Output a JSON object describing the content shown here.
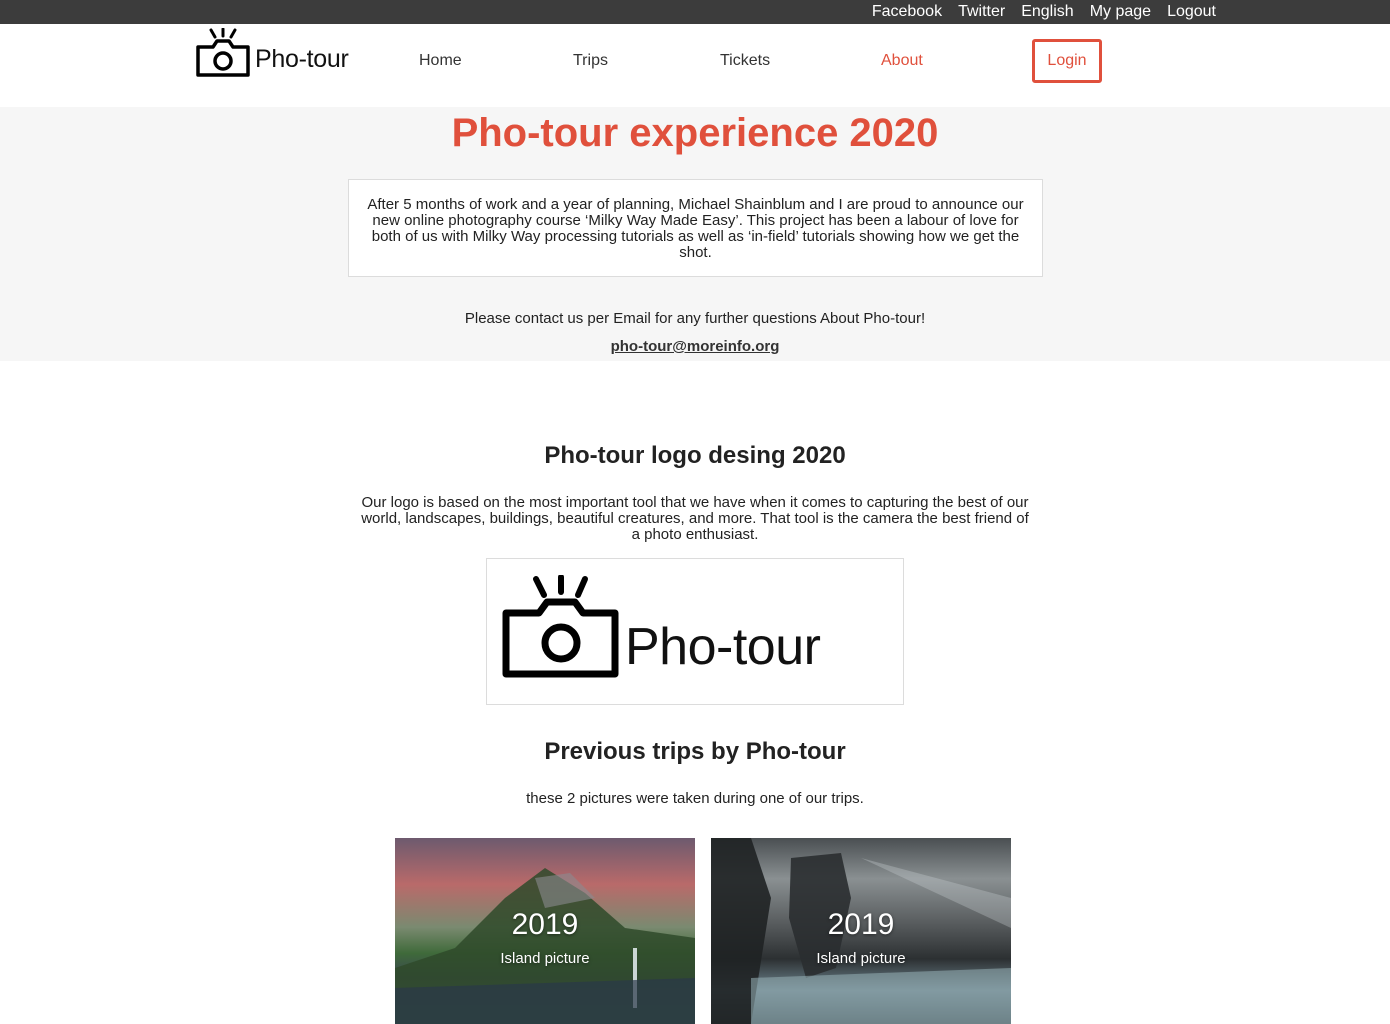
{
  "topbar": {
    "links": [
      "Facebook",
      "Twitter",
      "English",
      "My page",
      "Logout"
    ]
  },
  "header": {
    "logo_text": "Pho-tour",
    "nav": {
      "home": "Home",
      "trips": "Trips",
      "tickets": "Tickets",
      "about": "About"
    },
    "login_label": "Login",
    "accent_color": "#e0503c"
  },
  "hero": {
    "title": "Pho-tour experience 2020",
    "announcement": "After 5 months of work and a year of planning, Michael Shainblum and I are proud to announce our new online photography course ‘Milky Way Made Easy’. This project has been a labour of love for both of us with Milky Way processing tutorials as well as ‘in-field’ tutorials showing how we get the shot.",
    "contact_text": "Please contact us per Email for any further questions About Pho-tour!",
    "email": "pho-tour@moreinfo.org"
  },
  "logo_section": {
    "heading": "Pho-tour logo desing 2020",
    "description": "Our logo is based on the most important tool that we have when it comes to capturing the best of our world, landscapes, buildings, beautiful creatures, and more. That tool is the camera the best friend of a photo enthusiast.",
    "logo_text": "Pho-tour"
  },
  "trips_section": {
    "heading": "Previous trips by Pho-tour",
    "subtitle": "these 2 pictures were taken during one of our trips.",
    "cards": [
      {
        "year": "2019",
        "label": "Island picture"
      },
      {
        "year": "2019",
        "label": "Island picture"
      }
    ]
  }
}
